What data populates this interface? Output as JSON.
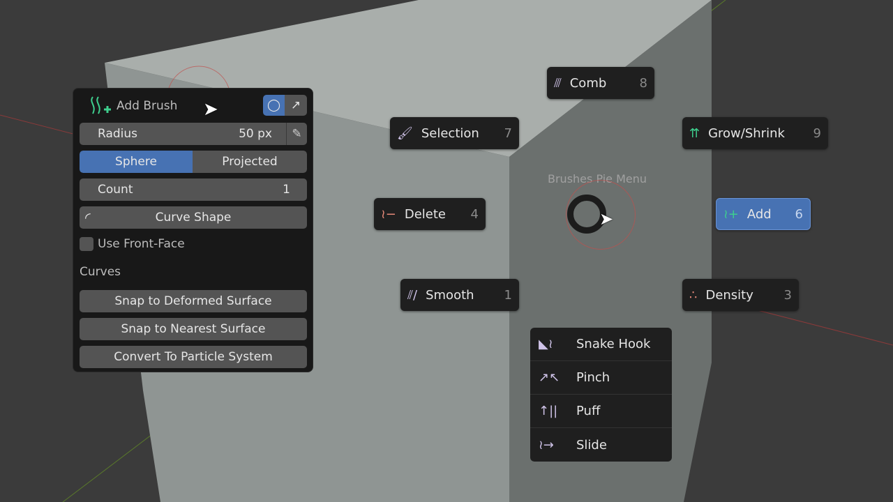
{
  "tool_settings": {
    "brush_name": "Add Brush",
    "radius_label": "Radius",
    "radius_value": "50 px",
    "falloff_options": [
      "Sphere",
      "Projected"
    ],
    "falloff_selected": "Sphere",
    "count_label": "Count",
    "count_value": "1",
    "curve_shape_label": "Curve Shape",
    "use_front_face_label": "Use Front-Face",
    "use_front_face_checked": false,
    "curves_section": "Curves",
    "snap_deformed": "Snap to Deformed Surface",
    "snap_nearest": "Snap to Nearest Surface",
    "convert_particle": "Convert To Particle System"
  },
  "pie_menu": {
    "title": "Brushes Pie Menu",
    "items": [
      {
        "label": "Comb",
        "key": "8"
      },
      {
        "label": "Selection",
        "key": "7"
      },
      {
        "label": "Grow/Shrink",
        "key": "9"
      },
      {
        "label": "Delete",
        "key": "4"
      },
      {
        "label": "Add",
        "key": "6",
        "active": true
      },
      {
        "label": "Smooth",
        "key": "1"
      },
      {
        "label": "Density",
        "key": "3"
      }
    ],
    "more": [
      "Snake Hook",
      "Pinch",
      "Puff",
      "Slide"
    ]
  },
  "colors": {
    "accent": "#4772b3",
    "add_icon": "#3ecf8e",
    "delete_icon": "#e88a7a",
    "brush_icon": "#cfc3e8"
  }
}
